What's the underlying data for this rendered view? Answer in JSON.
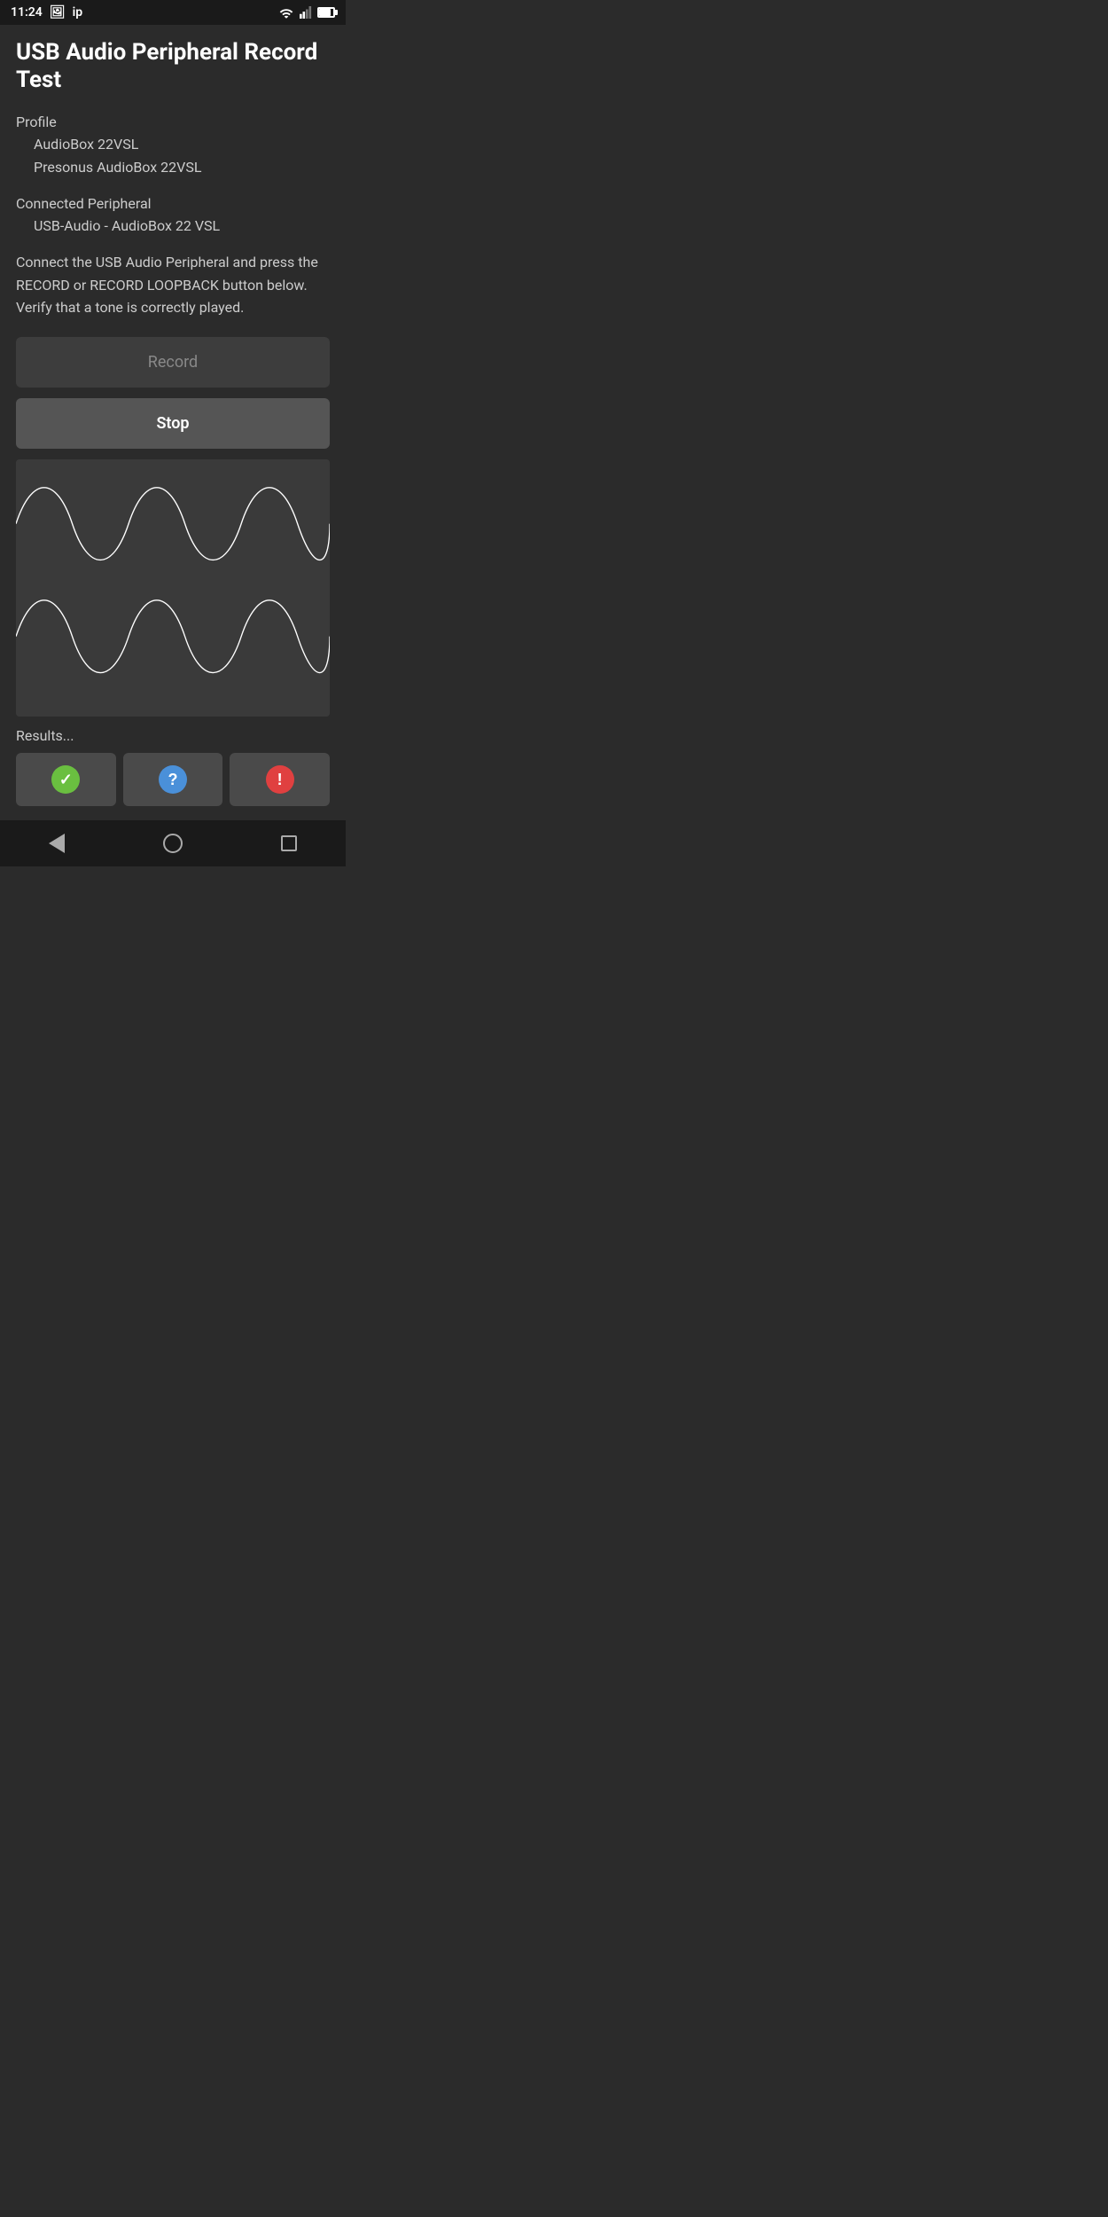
{
  "statusBar": {
    "time": "11:24",
    "appIcon": "image",
    "networkLabel": "ip"
  },
  "header": {
    "title": "USB Audio Peripheral Record Test"
  },
  "profile": {
    "label": "Profile",
    "line1": "AudioBox 22VSL",
    "line2": "Presonus AudioBox 22VSL"
  },
  "peripheral": {
    "label": "Connected Peripheral",
    "value": "USB-Audio - AudioBox 22 VSL"
  },
  "instruction": "Connect the USB Audio Peripheral and press the RECORD or RECORD LOOPBACK button below. Verify that a tone is correctly played.",
  "buttons": {
    "record": "Record",
    "stop": "Stop"
  },
  "results": {
    "label": "Results...",
    "passAlt": "pass",
    "questionAlt": "question",
    "failAlt": "fail"
  },
  "bottomNav": {
    "back": "back",
    "home": "home",
    "recent": "recent"
  }
}
